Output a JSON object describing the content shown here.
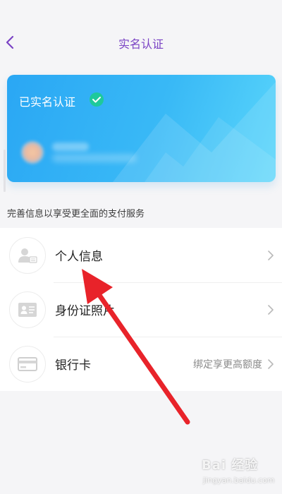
{
  "nav": {
    "title": "实名认证",
    "back_icon": "chevron-left-icon"
  },
  "card": {
    "status_label": "已实名认证",
    "check_icon": "check-circle-icon",
    "gradient_colors": [
      "#2aa7f4",
      "#5ad6fb"
    ]
  },
  "section_title": "完善信息以享受更全面的支付服务",
  "items": [
    {
      "label": "个人信息",
      "note": "",
      "icon": "user-card-icon"
    },
    {
      "label": "身份证照片",
      "note": "",
      "icon": "id-card-icon"
    },
    {
      "label": "银行卡",
      "note": "绑定享更高额度",
      "icon": "bank-card-icon"
    }
  ],
  "colors": {
    "accent": "#7a43c4",
    "check": "#1ec99b",
    "annotation_arrow": "#e8232a"
  },
  "watermark": {
    "main": "Bai 经验",
    "sub": "jingyan.baidu.com"
  }
}
